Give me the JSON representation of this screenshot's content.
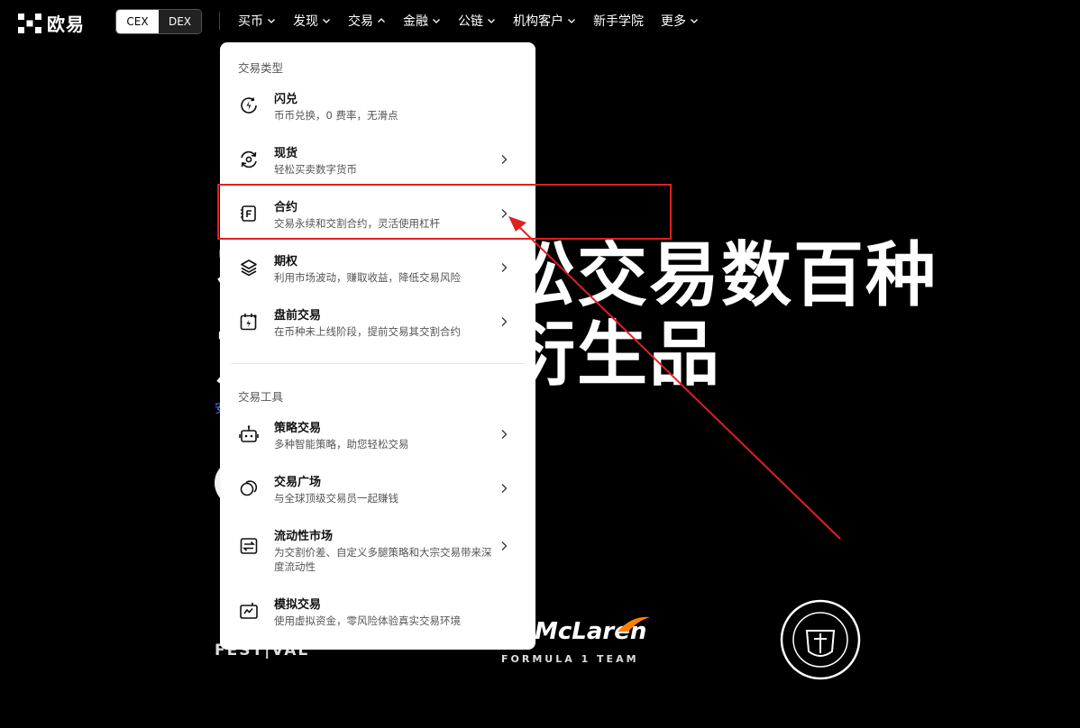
{
  "header": {
    "logo_text": "欧易",
    "toggle": {
      "cex": "CEX",
      "dex": "DEX"
    },
    "nav": [
      {
        "label": "买币",
        "expanded": false
      },
      {
        "label": "发现",
        "expanded": false
      },
      {
        "label": "交易",
        "expanded": true
      },
      {
        "label": "金融",
        "expanded": false
      },
      {
        "label": "公链",
        "expanded": false
      },
      {
        "label": "机构客户",
        "expanded": false
      },
      {
        "label": "新手学院",
        "expanded": null
      },
      {
        "label": "更多",
        "expanded": false
      }
    ]
  },
  "hero": {
    "title_line1": "在欧易轻松交易数百种",
    "title_line2": "加密货币衍生品",
    "sub_fragment": "安",
    "partners": {
      "festival": "FEST|VAL",
      "mclaren": "McLaren",
      "mclaren_sub": "FORMULA 1 TEAM",
      "city_badge": "MANCHESTER CITY"
    }
  },
  "dropdown": {
    "group1_title": "交易类型",
    "group1": [
      {
        "id": "flash",
        "icon": "flash-swap-icon",
        "title": "闪兑",
        "desc": "币币兑换，0 费率，无滑点",
        "has_arrow": false
      },
      {
        "id": "spot",
        "icon": "spot-icon",
        "title": "现货",
        "desc": "轻松买卖数字货币",
        "has_arrow": true
      },
      {
        "id": "futures",
        "icon": "futures-icon",
        "title": "合约",
        "desc": "交易永续和交割合约，灵活使用杠杆",
        "has_arrow": true
      },
      {
        "id": "options",
        "icon": "options-icon",
        "title": "期权",
        "desc": "利用市场波动，赚取收益，降低交易风险",
        "has_arrow": true
      },
      {
        "id": "premarket",
        "icon": "pre-market-icon",
        "title": "盘前交易",
        "desc": "在币种未上线阶段，提前交易其交割合约",
        "has_arrow": true
      }
    ],
    "group2_title": "交易工具",
    "group2": [
      {
        "id": "bots",
        "icon": "trading-bot-icon",
        "title": "策略交易",
        "desc": "多种智能策略，助您轻松交易",
        "has_arrow": true
      },
      {
        "id": "copy",
        "icon": "copy-trading-icon",
        "title": "交易广场",
        "desc": "与全球顶级交易员一起赚钱",
        "has_arrow": true
      },
      {
        "id": "liquidity",
        "icon": "liquidity-icon",
        "title": "流动性市场",
        "desc": "为交割价差、自定义多腿策略和大宗交易带来深度流动性",
        "has_arrow": true
      },
      {
        "id": "demo",
        "icon": "demo-trading-icon",
        "title": "模拟交易",
        "desc": "使用虚拟资金，零风险体验真实交易环境",
        "has_arrow": false
      }
    ]
  },
  "annotation": {
    "color": "#e02020",
    "target": "futures"
  }
}
